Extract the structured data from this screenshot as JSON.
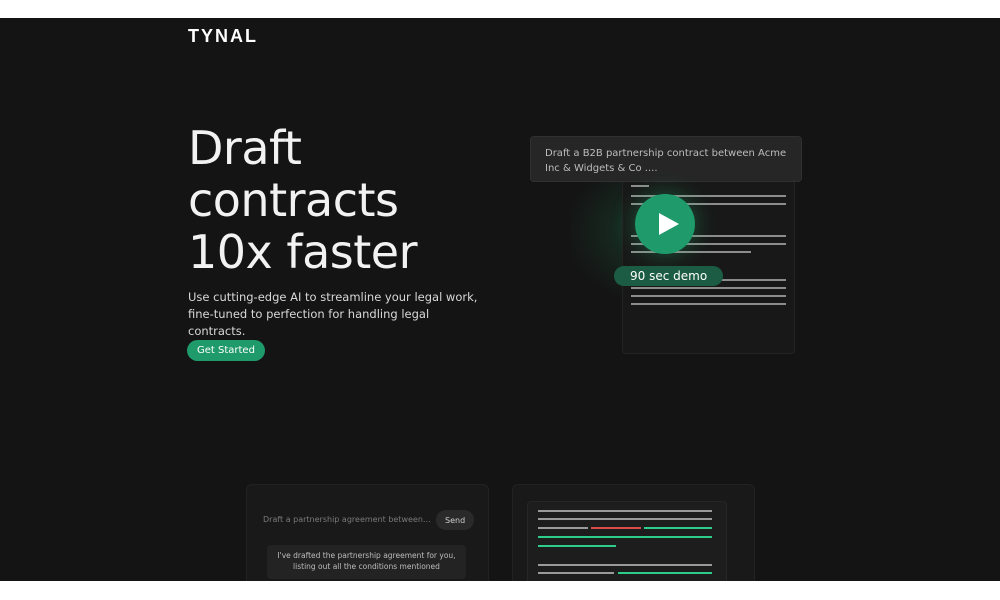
{
  "brand": {
    "logo": "TYNAL"
  },
  "hero": {
    "headline": [
      "Draft",
      "contracts",
      "10x faster"
    ],
    "subtitle": "Use cutting-edge AI to streamline your legal work, fine-tuned to perfection for handling legal contracts.",
    "cta_label": "Get Started"
  },
  "demo": {
    "prompt": "Draft a B2B partnership contract between Acme Inc & Widgets & Co ....",
    "badge": "90 sec demo"
  },
  "chat_card": {
    "input_placeholder": "Draft a partnership agreement between X Inc...",
    "send_label": "Send",
    "reply": "I've drafted the partnership agreement for you, listing out all the conditions mentioned"
  },
  "colors": {
    "accent": "#1f9a6b",
    "background": "#141414",
    "diff_added": "#2ecc8a",
    "diff_removed": "#d94b4b"
  }
}
